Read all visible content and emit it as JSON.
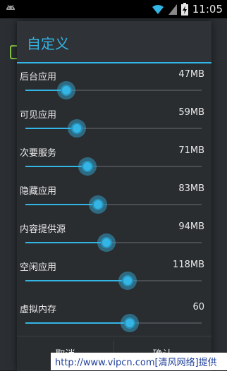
{
  "status_bar": {
    "time": "11:05",
    "icons": [
      "android-icon",
      "wifi-icon",
      "signal-icon",
      "battery-icon"
    ]
  },
  "dialog": {
    "title": "自定义",
    "items": [
      {
        "label": "后台应用",
        "value": "47MB",
        "level": 0.23
      },
      {
        "label": "可见应用",
        "value": "59MB",
        "level": 0.29
      },
      {
        "label": "次要服务",
        "value": "71MB",
        "level": 0.35
      },
      {
        "label": "隐藏应用",
        "value": "83MB",
        "level": 0.41
      },
      {
        "label": "内容提供源",
        "value": "94MB",
        "level": 0.46
      },
      {
        "label": "空闲应用",
        "value": "118MB",
        "level": 0.58
      },
      {
        "label": "虚拟内存",
        "value": "60",
        "level": 0.59
      }
    ],
    "cancel_label": "取消",
    "confirm_label": "确认"
  },
  "watermark": "http://www.vipcn.com[清风网络]提供",
  "colors": {
    "accent": "#33b5e5",
    "background": "#2a2d30"
  }
}
